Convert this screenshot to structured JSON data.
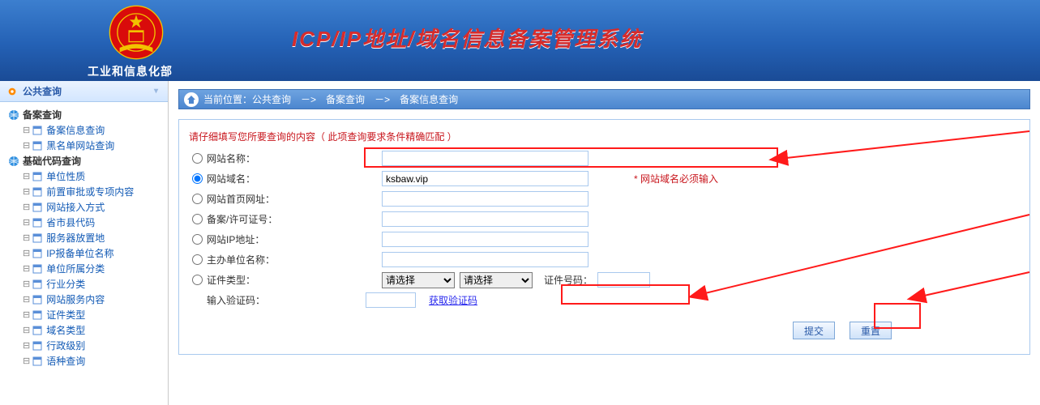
{
  "header": {
    "department": "工业和信息化部",
    "system_title": "ICP/IP地址/域名信息备案管理系统"
  },
  "sidebar": {
    "heading": "公共查询",
    "groups": [
      {
        "label": "备案查询",
        "children": [
          "备案信息查询",
          "黑名单网站查询"
        ]
      },
      {
        "label": "基础代码查询",
        "children": [
          "单位性质",
          "前置审批或专项内容",
          "网站接入方式",
          "省市县代码",
          "服务器放置地",
          "IP报备单位名称",
          "单位所属分类",
          "行业分类",
          "网站服务内容",
          "证件类型",
          "域名类型",
          "行政级别",
          "语种查询"
        ]
      }
    ]
  },
  "crumb": {
    "location_label": "当前位置：",
    "a": "公共查询",
    "sep": "－>",
    "b": "备案查询",
    "c": "备案信息查询"
  },
  "form": {
    "hint": "请仔细填写您所要查询的内容（ 此项查询要求条件精确匹配 ）",
    "rows": {
      "site_name": "网站名称：",
      "domain": "网站域名：",
      "homepage": "网站首页网址：",
      "license": "备案/许可证号：",
      "ip": "网站IP地址：",
      "sponsor": "主办单位名称：",
      "cert_type": "证件类型：",
      "captcha": "输入验证码："
    },
    "domain_value": "ksbaw.vip",
    "domain_required_note": "* 网站域名必须输入",
    "cert_id_label": "证件号码：",
    "select_placeholder": "请选择",
    "captcha_link": "获取验证码",
    "submit": "提交",
    "reset": "重置"
  }
}
